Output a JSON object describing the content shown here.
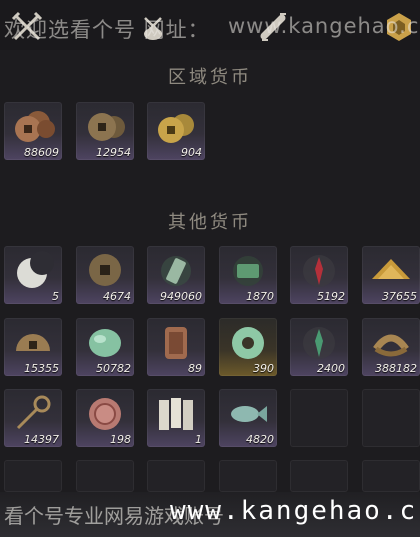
{
  "watermark": {
    "top_prefix": "欢迎选看个号 网址：",
    "top_site": "www.kangehao.c",
    "bottom_text": "看个号专业网易游戏账号",
    "bottom_url": "www.kangehao.c"
  },
  "toolbar": {
    "icons": [
      "crossed-swords-icon",
      "pouch-icon",
      "scroll-icon",
      "gold-badge-icon"
    ]
  },
  "sections": {
    "regional": {
      "title": "区域货币",
      "items": [
        {
          "icon": "copper-coin-stack-icon",
          "qty": "88609"
        },
        {
          "icon": "copper-coins-icon",
          "qty": "12954"
        },
        {
          "icon": "gold-coins-icon",
          "qty": "904"
        }
      ]
    },
    "other": {
      "title": "其他货币",
      "items": [
        {
          "icon": "crescent-moon-icon",
          "qty": "5"
        },
        {
          "icon": "square-hole-coin-icon",
          "qty": "4674"
        },
        {
          "icon": "jade-token-icon",
          "qty": "949060"
        },
        {
          "icon": "jade-ticket-icon",
          "qty": "1870"
        },
        {
          "icon": "red-spirit-icon",
          "qty": "5192"
        },
        {
          "icon": "golden-grain-icon",
          "qty": "37655"
        },
        {
          "icon": "half-moon-coin-icon",
          "qty": "15355"
        },
        {
          "icon": "jade-stone-icon",
          "qty": "50782"
        },
        {
          "icon": "bronze-tablet-icon",
          "qty": "89"
        },
        {
          "icon": "jade-disc-icon",
          "qty": "390"
        },
        {
          "icon": "green-spirit-icon",
          "qty": "2400"
        },
        {
          "icon": "coin-string-icon",
          "qty": "388182"
        },
        {
          "icon": "key-coin-icon",
          "qty": "14397"
        },
        {
          "icon": "red-seal-icon",
          "qty": "198"
        },
        {
          "icon": "paper-notes-icon",
          "qty": "1"
        },
        {
          "icon": "jade-fish-icon",
          "qty": "4820"
        }
      ]
    }
  },
  "colors": {
    "background": "#1d1c1f",
    "tile_bottom": "#4e4461",
    "rare_tile_bottom": "#6d5a2a",
    "quantity_text": "#f2efe9"
  }
}
